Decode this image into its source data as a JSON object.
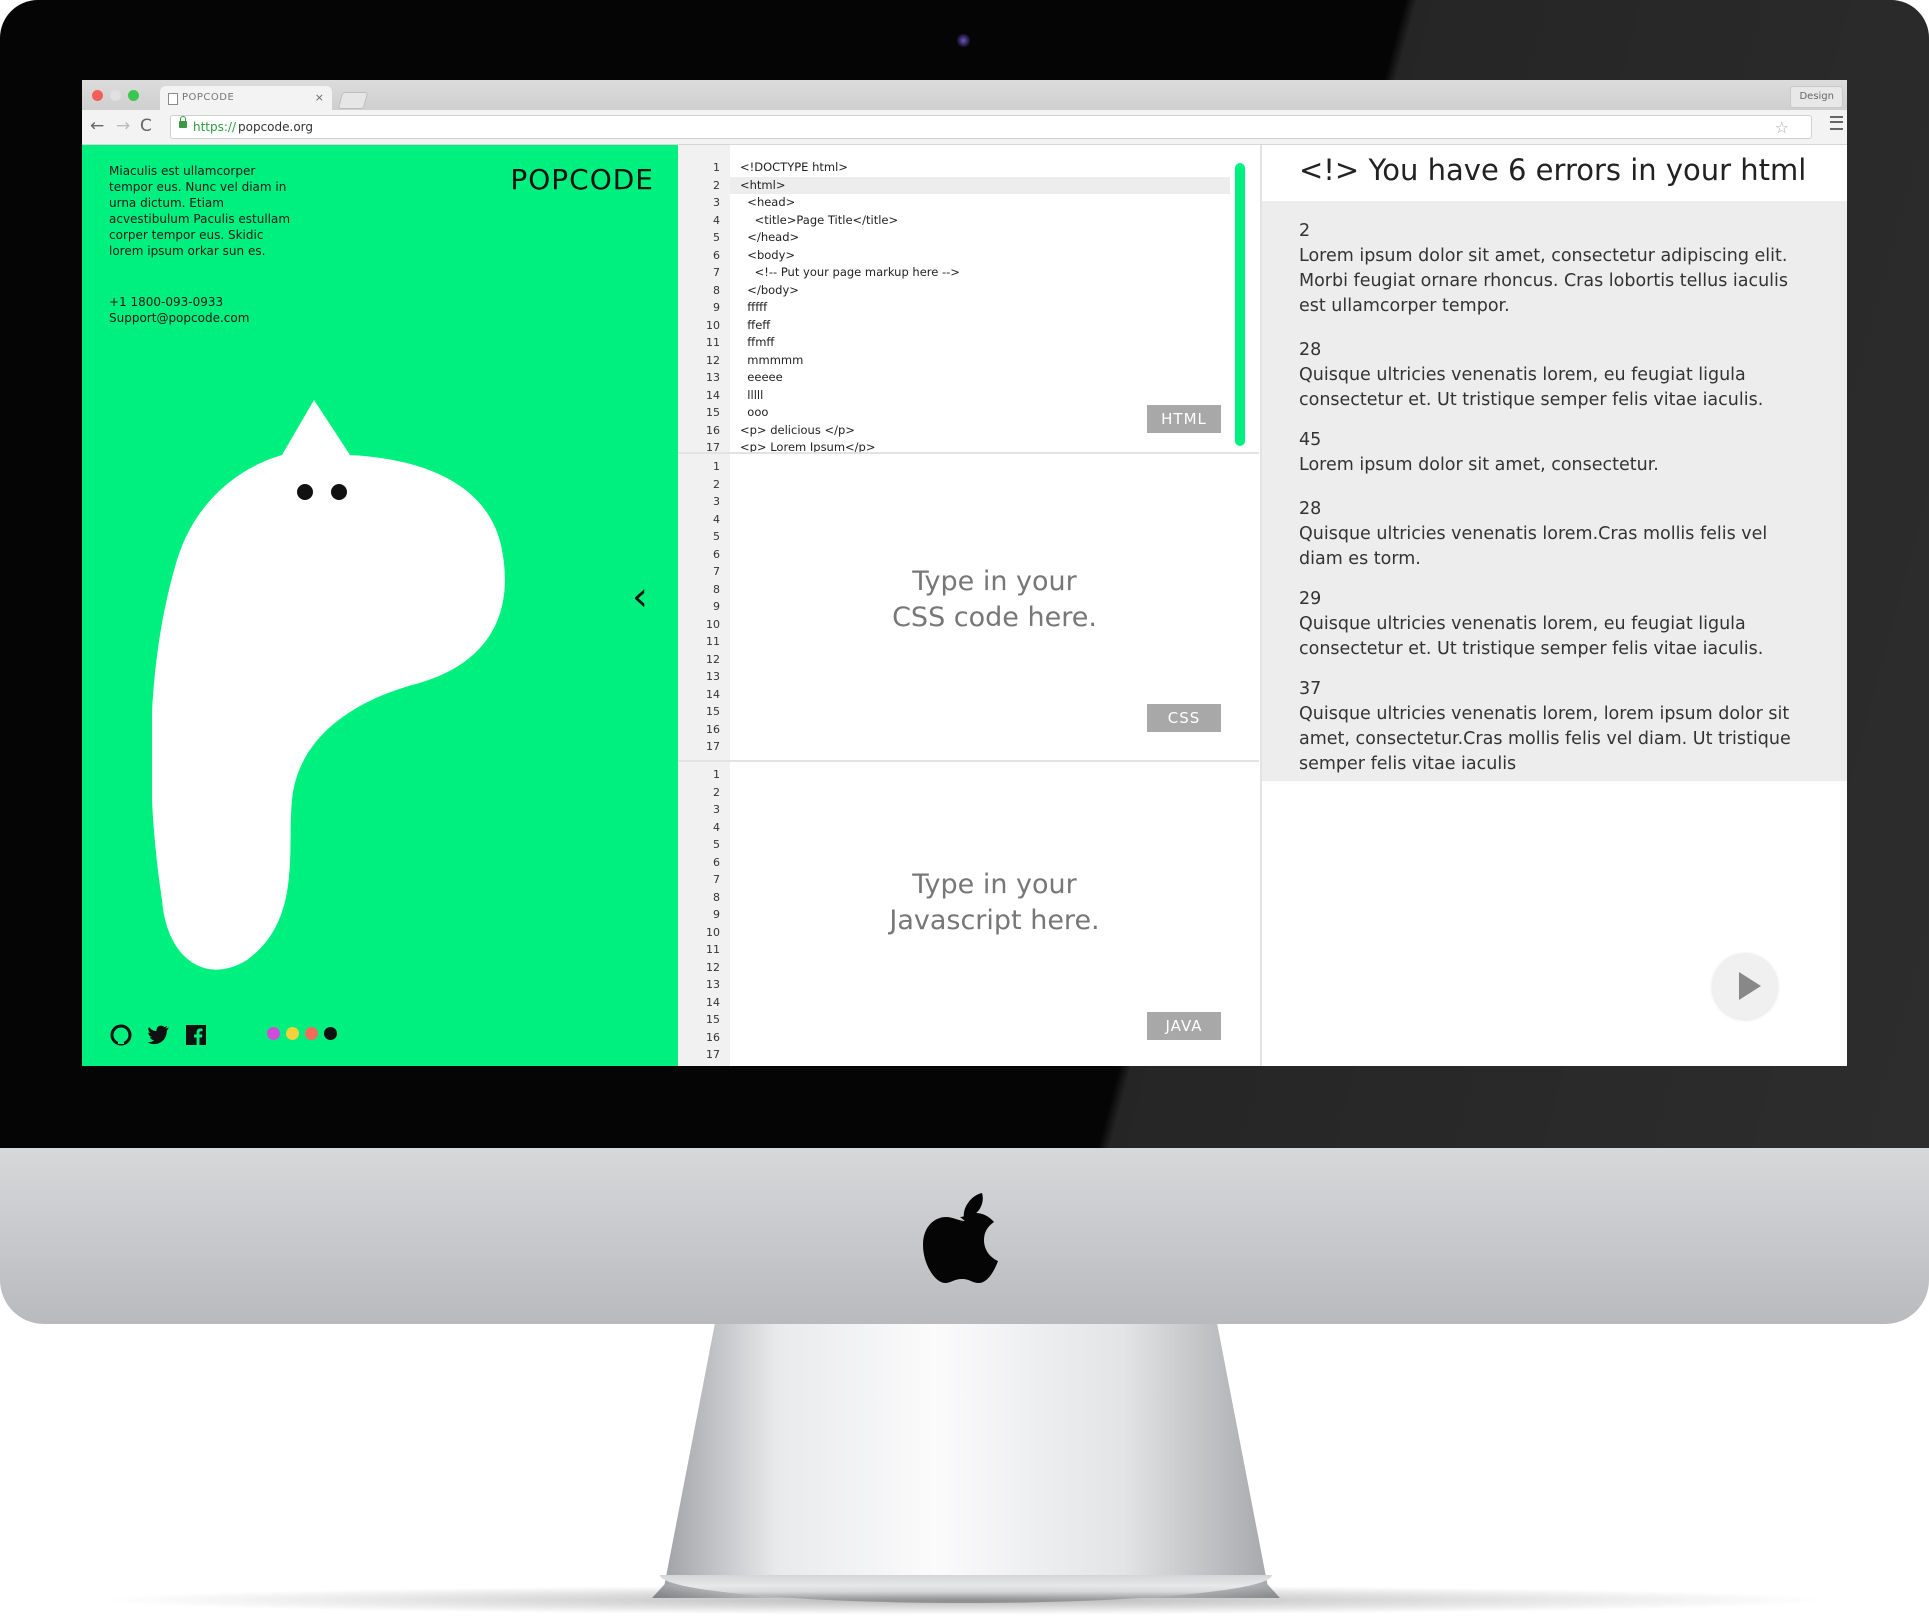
{
  "browser": {
    "tab_title": "POPCODE",
    "tab_close": "×",
    "design_button": "Design",
    "url_scheme": "https://",
    "url_host": "popcode.org",
    "nav_back": "←",
    "nav_forward": "→",
    "nav_reload": "C",
    "bookmark_star": "☆"
  },
  "sidebar": {
    "brand": "POPCODE",
    "about": "Miaculis est ullamcorper tempor eus. Nunc vel diam in urna dictum. Etiam acvestibulum Paculis estullam corper tempor eus. Skidic lorem ipsum orkar sun es.",
    "phone": "+1 1800-093-0933",
    "email": "Support@popcode.com",
    "collapse_arrow": "‹",
    "social_icons": [
      "github-icon",
      "twitter-icon",
      "facebook-icon"
    ],
    "theme_dots": [
      "#d14bd9",
      "#f5d23b",
      "#f26b5b",
      "#111111"
    ],
    "accent_color": "#00f07f"
  },
  "editors": {
    "html": {
      "badge": "HTML",
      "line_numbers": [
        "1",
        "2",
        "3",
        "4",
        "5",
        "6",
        "7",
        "8",
        "9",
        "10",
        "11",
        "12",
        "13",
        "14",
        "15",
        "16",
        "17"
      ],
      "lines": [
        "<!DOCTYPE html>",
        "<html>",
        "  <head>",
        "    <title>Page Title</title>",
        "  </head>",
        "  <body>",
        "    <!-- Put your page markup here -->",
        "  </body>",
        "  fffff",
        "  ffeff",
        "  ffmff",
        "  mmmmm",
        "  eeeee",
        "  lllll",
        "  ooo",
        "<p> delicious </p>",
        "<p> Lorem Ipsum</p>"
      ]
    },
    "css": {
      "badge": "CSS",
      "placeholder_line1": "Type in your",
      "placeholder_line2": "CSS code here.",
      "line_numbers": [
        "1",
        "2",
        "3",
        "4",
        "5",
        "6",
        "7",
        "8",
        "9",
        "10",
        "11",
        "12",
        "13",
        "14",
        "15",
        "16",
        "17"
      ]
    },
    "js": {
      "badge": "JAVA",
      "placeholder_line1": "Type in your",
      "placeholder_line2": "Javascript here.",
      "line_numbers": [
        "1",
        "2",
        "3",
        "4",
        "5",
        "6",
        "7",
        "8",
        "9",
        "10",
        "11",
        "12",
        "13",
        "14",
        "15",
        "16",
        "17"
      ]
    }
  },
  "errors": {
    "title": "<!> You have 6 errors in your html",
    "items": [
      {
        "line": "2",
        "message": "Lorem ipsum dolor sit amet, consectetur adipiscing elit. Morbi feugiat ornare rhoncus. Cras lobortis tellus iaculis est ullamcorper tempor."
      },
      {
        "line": "28",
        "message": "Quisque ultricies venenatis lorem, eu feugiat ligula consectetur et. Ut tristique semper felis vitae iaculis."
      },
      {
        "line": "45",
        "message": "Lorem ipsum dolor sit amet, consectetur."
      },
      {
        "line": "28",
        "message": "Quisque ultricies venenatis lorem.Cras mollis felis vel diam es torm."
      },
      {
        "line": "29",
        "message": "Quisque ultricies venenatis lorem, eu feugiat ligula consectetur et. Ut tristique semper felis vitae iaculis."
      },
      {
        "line": "37",
        "message": "Quisque ultricies venenatis lorem, lorem ipsum dolor sit amet, consectetur.Cras mollis felis vel diam. Ut tristique semper felis vitae iaculis"
      }
    ],
    "run_icon": "play-icon"
  }
}
